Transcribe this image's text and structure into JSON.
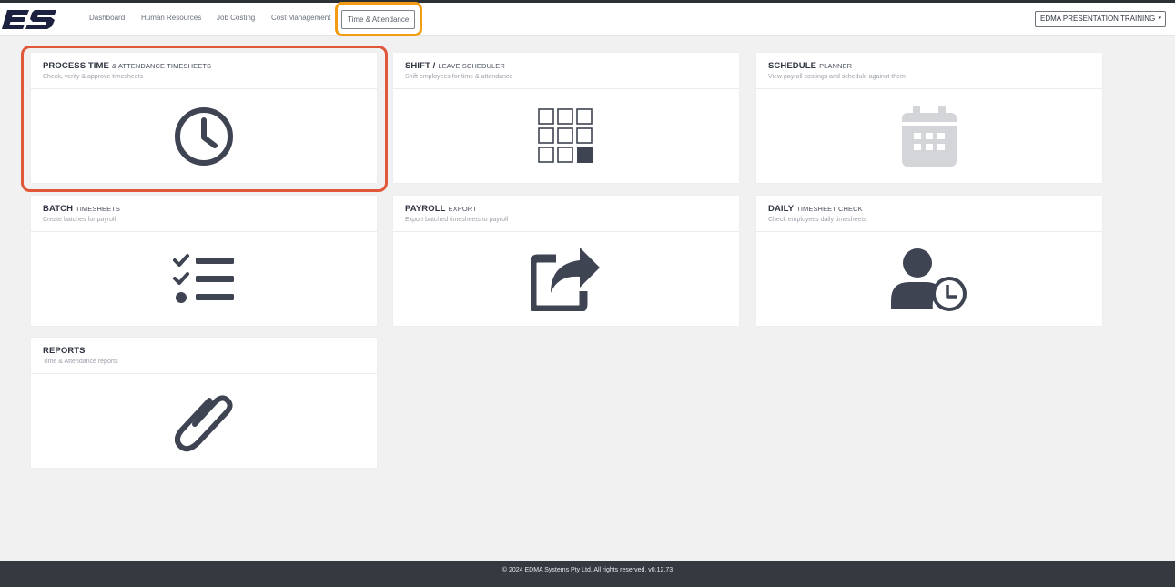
{
  "brand": {
    "logo_text": "ES"
  },
  "nav": {
    "items": [
      {
        "label": "Dashboard"
      },
      {
        "label": "Human Resources"
      },
      {
        "label": "Job Costing"
      },
      {
        "label": "Cost Management"
      },
      {
        "label": "Time & Attendance",
        "active": true
      }
    ]
  },
  "company_select": {
    "value": "EDMA PRESENTATION TRAINING",
    "caret": "▾"
  },
  "cards": [
    {
      "title": "PROCESS TIME",
      "subtitle": "& ATTENDANCE TIMESHEETS",
      "description": "Check, verify & approve timesheets",
      "icon": "clock-icon"
    },
    {
      "title": "SHIFT /",
      "subtitle": "LEAVE SCHEDULER",
      "description": "Shift employees for time & attendance",
      "icon": "grid-icon"
    },
    {
      "title": "SCHEDULE",
      "subtitle": "PLANNER",
      "description": "View payroll costings and schedule against them",
      "icon": "calendar-icon"
    },
    {
      "title": "BATCH",
      "subtitle": "TIMESHEETS",
      "description": "Create batches for payroll",
      "icon": "checklist-icon"
    },
    {
      "title": "PAYROLL",
      "subtitle": "EXPORT",
      "description": "Export batched timesheets to payroll",
      "icon": "share-export-icon"
    },
    {
      "title": "DAILY",
      "subtitle": "TIMESHEET CHECK",
      "description": "Check employees daily timesheets",
      "icon": "user-clock-icon"
    },
    {
      "title": "REPORTS",
      "subtitle": "",
      "description": "Time & Attendance reports",
      "icon": "paperclip-icon"
    }
  ],
  "footer": {
    "text": "© 2024 EDMA Systems Pty Ltd. All rights reserved.",
    "version": "v0.12.73"
  },
  "colors": {
    "icon": "#3e4452",
    "icon_muted": "#d4d5d8",
    "highlight_red": "#e0573a",
    "highlight_orange": "#f39c12",
    "footer_bg": "#343a40"
  }
}
